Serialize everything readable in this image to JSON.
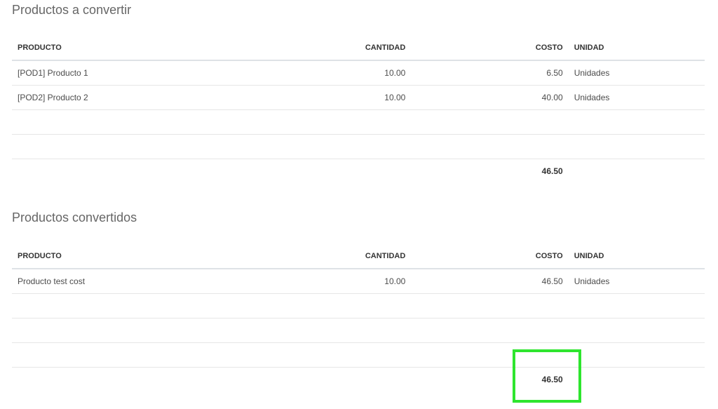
{
  "sections": [
    {
      "title": "Productos a convertir",
      "columns": {
        "product": "PRODUCTO",
        "quantity": "CANTIDAD",
        "cost": "COSTO",
        "unit": "UNIDAD"
      },
      "rows": [
        {
          "product": "[POD1] Producto 1",
          "quantity": "10.00",
          "cost": "6.50",
          "unit": "Unidades"
        },
        {
          "product": "[POD2] Producto 2",
          "quantity": "10.00",
          "cost": "40.00",
          "unit": "Unidades"
        }
      ],
      "total_cost": "46.50"
    },
    {
      "title": "Productos convertidos",
      "columns": {
        "product": "PRODUCTO",
        "quantity": "CANTIDAD",
        "cost": "COSTO",
        "unit": "UNIDAD"
      },
      "rows": [
        {
          "product": "Producto test cost",
          "quantity": "10.00",
          "cost": "46.50",
          "unit": "Unidades"
        }
      ],
      "total_cost": "46.50"
    }
  ],
  "highlight": {
    "color": "#2ee52e",
    "target": "converted-total-cost"
  }
}
